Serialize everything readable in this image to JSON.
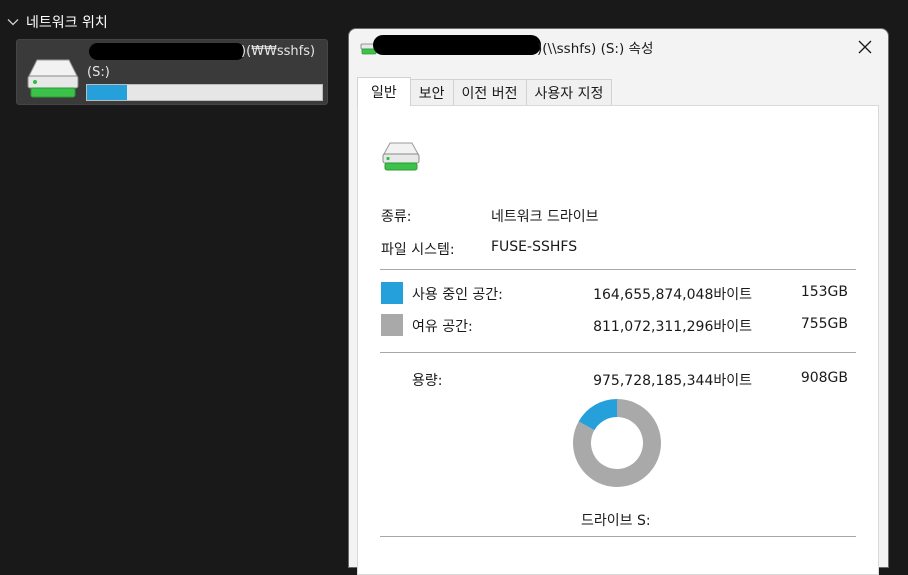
{
  "explorer": {
    "section_label": "네트워크 위치",
    "drive": {
      "name_visible": ")(₩₩sshfs)",
      "letter": "(S:)",
      "used_fraction": 0.169
    }
  },
  "dialog": {
    "title_visible": ")(\\\\sshfs) (S:) 속성",
    "tabs": [
      {
        "label": "일반",
        "active": true
      },
      {
        "label": "보안",
        "active": false
      },
      {
        "label": "이전 버전",
        "active": false
      },
      {
        "label": "사용자 지정",
        "active": false
      }
    ],
    "type_label": "종류:",
    "type_value": "네트워크 드라이브",
    "fs_label": "파일 시스템:",
    "fs_value": "FUSE-SSHFS",
    "used": {
      "label": "사용 중인 공간:",
      "bytes": "164,655,874,048바이트",
      "size": "153GB",
      "color": "#26a0da"
    },
    "free": {
      "label": "여유 공간:",
      "bytes": "811,072,311,296바이트",
      "size": "755GB",
      "color": "#a9a9a9"
    },
    "capacity": {
      "label": "용량:",
      "bytes": "975,728,185,344바이트",
      "size": "908GB"
    },
    "drive_label": "드라이브 S:"
  },
  "chart_data": {
    "type": "pie",
    "categories": [
      "사용 중인 공간",
      "여유 공간"
    ],
    "values": [
      164655874048,
      811072311296
    ],
    "colors": [
      "#26a0da",
      "#a9a9a9"
    ]
  }
}
